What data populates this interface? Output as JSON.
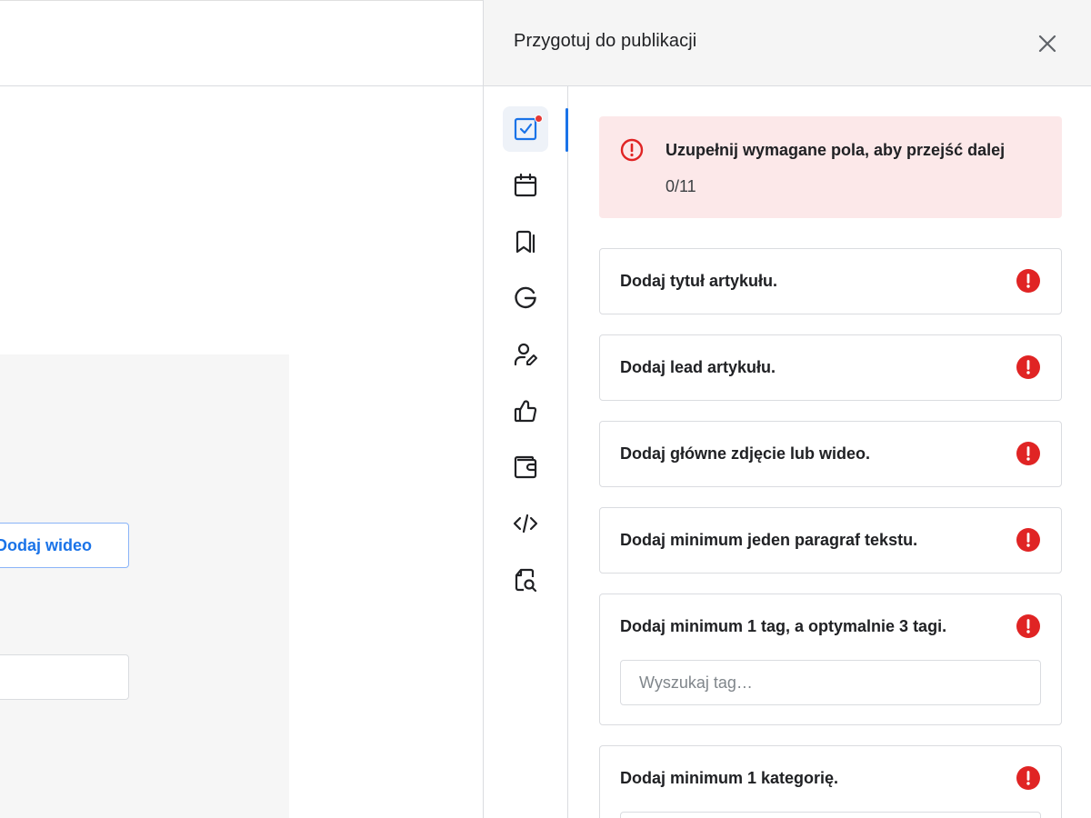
{
  "editor": {
    "add_video_label": "Dodaj wideo"
  },
  "drawer": {
    "title": "Przygotuj do publikacji",
    "close_icon": "close-icon",
    "rail": [
      {
        "icon": "checklist-icon",
        "active": true,
        "has_dot": true
      },
      {
        "icon": "calendar-icon"
      },
      {
        "icon": "bookmarks-icon"
      },
      {
        "icon": "google-icon"
      },
      {
        "icon": "author-edit-icon"
      },
      {
        "icon": "thumb-up-icon"
      },
      {
        "icon": "wallet-icon"
      },
      {
        "icon": "code-icon"
      },
      {
        "icon": "file-search-icon"
      }
    ],
    "alert": {
      "title": "Uzupełnij wymagane pola, aby przejść dalej",
      "count": "0/11"
    },
    "requirements": [
      {
        "label": "Dodaj tytuł artykułu."
      },
      {
        "label": "Dodaj lead artykułu."
      },
      {
        "label": "Dodaj główne zdjęcie lub wideo."
      },
      {
        "label": "Dodaj minimum jeden paragraf tekstu."
      },
      {
        "label": "Dodaj minimum 1 tag, a optymalnie 3 tagi.",
        "input_placeholder": "Wyszukaj tag…"
      },
      {
        "label": "Dodaj minimum 1 kategorię."
      }
    ]
  },
  "colors": {
    "accent": "#1a73e8",
    "error": "#e02424",
    "alert_bg": "#fce8e9"
  }
}
